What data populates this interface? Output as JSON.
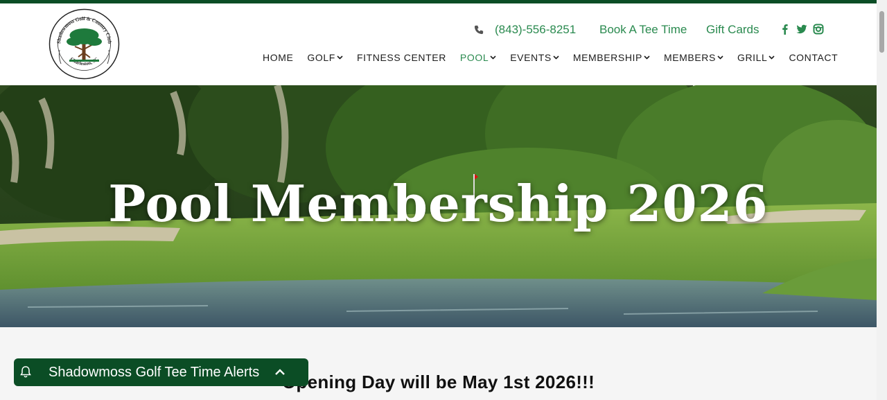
{
  "brand": {
    "logo_name": "Shadowmoss Golf & Country Club",
    "logo_location": "Charleston, SC",
    "logo_icon": "oak-tree-icon"
  },
  "utility": {
    "phone": "(843)-556-8251",
    "book_tee_time": "Book A Tee Time",
    "gift_cards": "Gift Cards",
    "social": [
      "facebook-icon",
      "twitter-icon",
      "instagram-icon"
    ]
  },
  "nav": {
    "items": [
      {
        "label": "HOME",
        "dropdown": false
      },
      {
        "label": "GOLF",
        "dropdown": true
      },
      {
        "label": "FITNESS CENTER",
        "dropdown": false
      },
      {
        "label": "POOL",
        "dropdown": true,
        "active": true
      },
      {
        "label": "EVENTS",
        "dropdown": true
      },
      {
        "label": "MEMBERSHIP",
        "dropdown": true
      },
      {
        "label": "MEMBERS",
        "dropdown": true
      },
      {
        "label": "GRILL",
        "dropdown": true
      },
      {
        "label": "CONTACT",
        "dropdown": false
      }
    ]
  },
  "hero": {
    "title": "Pool Membership 2026"
  },
  "content": {
    "opening_day": "Opening Day will be May 1st 2026!!!"
  },
  "alert_widget": {
    "label": "Shadowmoss Golf Tee Time Alerts"
  },
  "colors": {
    "brand_green": "#0b4d25",
    "link_green": "#2a8a4f"
  }
}
